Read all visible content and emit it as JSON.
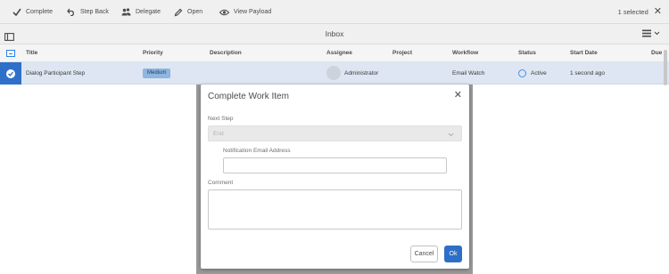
{
  "toolbar": {
    "complete": "Complete",
    "step_back": "Step Back",
    "delegate": "Delegate",
    "open": "Open",
    "view_payload": "View Payload",
    "selected": "1 selected"
  },
  "titlebar": {
    "title": "Inbox"
  },
  "table": {
    "columns": [
      "Title",
      "Priority",
      "Description",
      "Assignee",
      "Project",
      "Workflow",
      "Status",
      "Start Date",
      "Due I"
    ],
    "row": {
      "title": "Dialog Participant Step",
      "priority": "Medium",
      "description": "",
      "assignee": "Administrator",
      "project": "",
      "workflow": "Email Watch",
      "status": "Active",
      "start_date": "1 second ago"
    }
  },
  "dialog": {
    "title": "Complete Work Item",
    "next_step_label": "Next Step",
    "next_step_value": "End",
    "email_label": "Notification Email Address",
    "email_value": "",
    "comment_label": "Comment",
    "comment_value": "",
    "cancel": "Cancel",
    "ok": "Ok"
  },
  "colors": {
    "accent": "#2d6fc6",
    "selected_row": "#dde6f2",
    "priority_badge": "#8eb6e0"
  }
}
